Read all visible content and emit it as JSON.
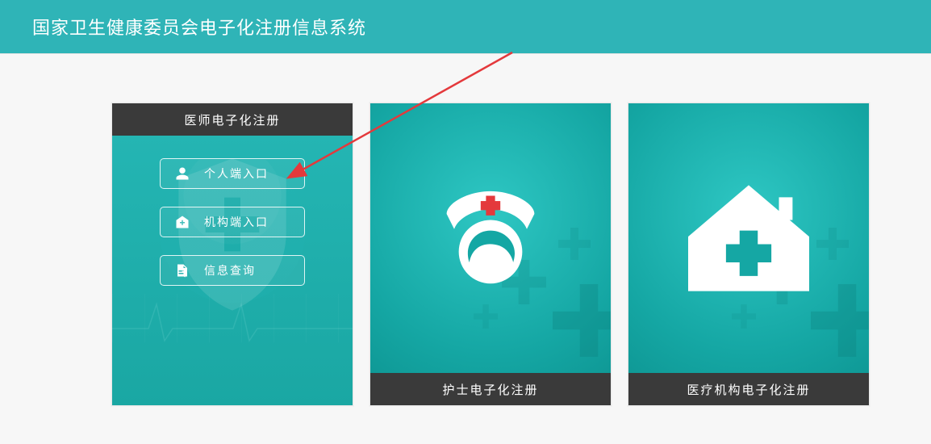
{
  "header": {
    "title": "国家卫生健康委员会电子化注册信息系统"
  },
  "cards": {
    "doctor": {
      "title": "医师电子化注册",
      "buttons": [
        {
          "icon": "person-icon",
          "label": "个人端入口"
        },
        {
          "icon": "hospital-badge-icon",
          "label": "机构端入口"
        },
        {
          "icon": "doc-search-icon",
          "label": "信息查询"
        }
      ]
    },
    "nurse": {
      "title": "护士电子化注册"
    },
    "org": {
      "title": "医疗机构电子化注册"
    }
  },
  "colors": {
    "header_teal": "#2fb4b7",
    "card_teal_light": "#2ec7c3",
    "card_teal_dark": "#15a7a4",
    "card_header_black": "#3a3a3a",
    "annotation_red": "#e4393c"
  },
  "annotation": {
    "description": "red arrow pointing to the 个人端入口 button on the first card"
  }
}
